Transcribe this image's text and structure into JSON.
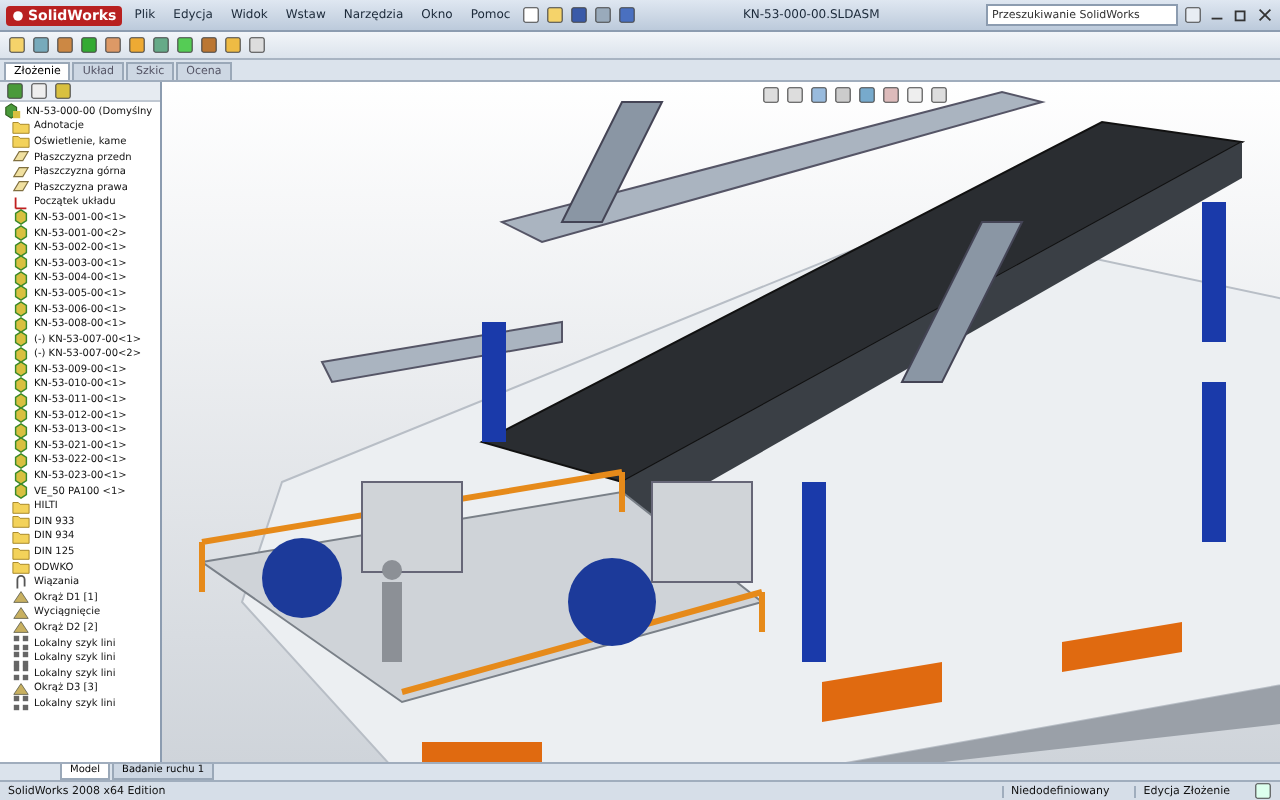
{
  "window": {
    "app_name": "SolidWorks",
    "title": "KN-53-000-00.SLDASM"
  },
  "menu": [
    "Plik",
    "Edycja",
    "Widok",
    "Wstaw",
    "Narzędzia",
    "Okno",
    "Pomoc"
  ],
  "search": {
    "placeholder": "Przeszukiwanie SolidWorks"
  },
  "command_tabs": [
    {
      "label": "Złożenie",
      "selected": true
    },
    {
      "label": "Układ",
      "selected": false
    },
    {
      "label": "Szkic",
      "selected": false
    },
    {
      "label": "Ocena",
      "selected": false
    }
  ],
  "tree": [
    {
      "kind": "root",
      "label": "KN-53-000-00 (Domyślny"
    },
    {
      "kind": "folder",
      "label": "Adnotacje"
    },
    {
      "kind": "folder",
      "label": "Oświetlenie, kame"
    },
    {
      "kind": "plane",
      "label": "Płaszczyzna przedn"
    },
    {
      "kind": "plane",
      "label": "Płaszczyzna górna"
    },
    {
      "kind": "plane",
      "label": "Płaszczyzna prawa"
    },
    {
      "kind": "origin",
      "label": "Początek układu"
    },
    {
      "kind": "part",
      "label": "KN-53-001-00<1>"
    },
    {
      "kind": "part",
      "label": "KN-53-001-00<2>"
    },
    {
      "kind": "part",
      "label": "KN-53-002-00<1>"
    },
    {
      "kind": "part",
      "label": "KN-53-003-00<1>"
    },
    {
      "kind": "part",
      "label": "KN-53-004-00<1>"
    },
    {
      "kind": "part",
      "label": "KN-53-005-00<1>"
    },
    {
      "kind": "part",
      "label": "KN-53-006-00<1>"
    },
    {
      "kind": "part",
      "label": "KN-53-008-00<1>"
    },
    {
      "kind": "part",
      "label": "(-) KN-53-007-00<1>"
    },
    {
      "kind": "part",
      "label": "(-) KN-53-007-00<2>"
    },
    {
      "kind": "part",
      "label": "KN-53-009-00<1>"
    },
    {
      "kind": "part",
      "label": "KN-53-010-00<1>"
    },
    {
      "kind": "part",
      "label": "KN-53-011-00<1>"
    },
    {
      "kind": "part",
      "label": "KN-53-012-00<1>"
    },
    {
      "kind": "part",
      "label": "KN-53-013-00<1>"
    },
    {
      "kind": "part",
      "label": "KN-53-021-00<1>"
    },
    {
      "kind": "part",
      "label": "KN-53-022-00<1>"
    },
    {
      "kind": "part",
      "label": "KN-53-023-00<1>"
    },
    {
      "kind": "part",
      "label": "VE_50 PA100 <1>"
    },
    {
      "kind": "folder",
      "label": "HILTI"
    },
    {
      "kind": "folder",
      "label": "DIN 933"
    },
    {
      "kind": "folder",
      "label": "DIN 934"
    },
    {
      "kind": "folder",
      "label": "DIN 125"
    },
    {
      "kind": "folder",
      "label": "ODWKO"
    },
    {
      "kind": "mates",
      "label": "Wiązania"
    },
    {
      "kind": "feature",
      "label": "Okrąż D1 [1]"
    },
    {
      "kind": "feature",
      "label": "Wyciągnięcie"
    },
    {
      "kind": "feature",
      "label": "Okrąż D2 [2]"
    },
    {
      "kind": "pattern",
      "label": "Lokalny szyk lini"
    },
    {
      "kind": "pattern",
      "label": "Lokalny szyk lini"
    },
    {
      "kind": "pattern",
      "label": "Lokalny szyk lini"
    },
    {
      "kind": "feature",
      "label": "Okrąż D3 [3]"
    },
    {
      "kind": "pattern",
      "label": "Lokalny szyk lini"
    }
  ],
  "bottom_tabs": [
    {
      "label": "Model",
      "selected": true
    },
    {
      "label": "Badanie ruchu 1",
      "selected": false
    }
  ],
  "status_bar": {
    "edition": "SolidWorks 2008 x64 Edition",
    "state": "Niedodefiniowany",
    "mode": "Edycja Złożenie"
  }
}
